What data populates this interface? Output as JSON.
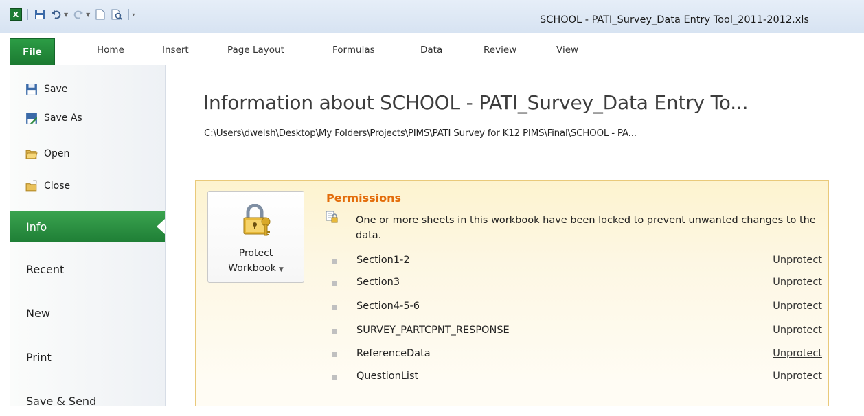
{
  "window": {
    "title": "SCHOOL - PATI_Survey_Data Entry Tool_2011-2012.xls",
    "app_logo": "X"
  },
  "quick_access": {
    "icons": [
      "excel-logo-icon",
      "save-icon",
      "undo-icon",
      "redo-icon",
      "new-icon",
      "print-preview-icon",
      "customize-icon"
    ]
  },
  "ribbon": {
    "tabs": [
      "File",
      "Home",
      "Insert",
      "Page Layout",
      "Formulas",
      "Data",
      "Review",
      "View"
    ]
  },
  "nav": {
    "save": "Save",
    "save_as": "Save As",
    "open": "Open",
    "close": "Close",
    "info": "Info",
    "recent": "Recent",
    "new": "New",
    "print": "Print",
    "save_send": "Save & Send"
  },
  "main": {
    "title": "Information about SCHOOL - PATI_Survey_Data Entry To...",
    "path": "C:\\Users\\dwelsh\\Desktop\\My Folders\\Projects\\PIMS\\PATI Survey for K12 PIMS\\Final\\SCHOOL - PA..."
  },
  "permissions": {
    "protect_line1": "Protect",
    "protect_line2": "Workbook",
    "heading": "Permissions",
    "description": "One or more sheets in this workbook have been locked to prevent unwanted changes to the data.",
    "sheets": [
      {
        "name": "Section1-2",
        "action": "Unprotect"
      },
      {
        "name": "Section3",
        "action": "Unprotect"
      },
      {
        "name": "Section4-5-6",
        "action": "Unprotect"
      },
      {
        "name": "SURVEY_PARTCPNT_RESPONSE",
        "action": "Unprotect"
      },
      {
        "name": "ReferenceData",
        "action": "Unprotect"
      },
      {
        "name": "QuestionList",
        "action": "Unprotect"
      }
    ]
  },
  "colors": {
    "file_tab_green": "#1b7a31",
    "info_active_green": "#2a9341",
    "permissions_heading": "#e36c0a",
    "panel_bg": "#fdf3cf",
    "panel_border": "#e9c97a"
  }
}
